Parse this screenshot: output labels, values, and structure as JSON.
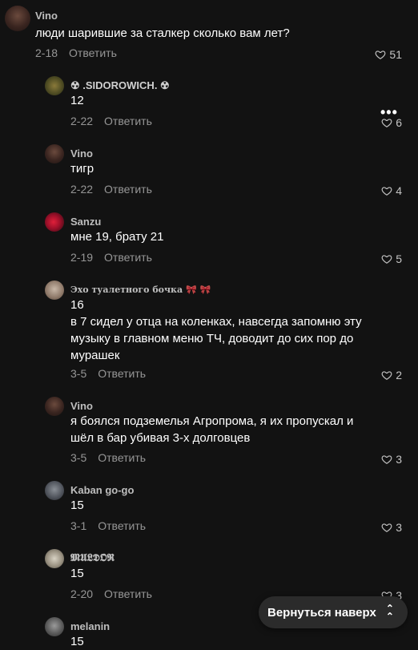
{
  "comments": [
    {
      "name": "Vino",
      "text": "люди шарившие за сталкер сколько вам лет?",
      "date": "2-18",
      "reply_label": "Ответить",
      "likes": "51"
    },
    {
      "name": "☢ .SIDOROWICH. ☢",
      "text": "12",
      "date": "2-22",
      "reply_label": "Ответить",
      "likes": "6"
    },
    {
      "name": "Vino",
      "text": "тигр",
      "date": "2-22",
      "reply_label": "Ответить",
      "likes": "4"
    },
    {
      "name": "Sanzu",
      "text": "мне 19, брату 21",
      "date": "2-19",
      "reply_label": "Ответить",
      "likes": "5"
    },
    {
      "name": "Эхо туалетного бочка 🎀 🎀",
      "text": "16\nв 7 сидел у отца на коленках, навсегда запомню эту музыку в главном меню ТЧ, доводит до сих пор до мурашек",
      "date": "3-5",
      "reply_label": "Ответить",
      "likes": "2"
    },
    {
      "name": "Vino",
      "text": "я боялся подземелья Агропрома, я их пропускал и шёл в бар убивая 3-х долговцев",
      "date": "3-5",
      "reply_label": "Ответить",
      "likes": "3"
    },
    {
      "name": "Kaban go-go",
      "text": "15",
      "date": "3-1",
      "reply_label": "Ответить",
      "likes": "3"
    },
    {
      "name": "𝕸𝖀𝕷𝕯𝕺𝕽",
      "text": "15",
      "date": "2-20",
      "reply_label": "Ответить",
      "likes": "3"
    },
    {
      "name": "melanin",
      "text": "15",
      "date": "",
      "reply_label": "",
      "likes": ""
    }
  ],
  "more_icon": "more-dots-icon",
  "back_to_top": {
    "label": "Вернуться наверх",
    "icon": "chevrons-up-icon"
  },
  "colors": {
    "background": "#121212",
    "text": "#ffffff",
    "muted": "#8c8c8c",
    "button": "#2b2b2b"
  }
}
